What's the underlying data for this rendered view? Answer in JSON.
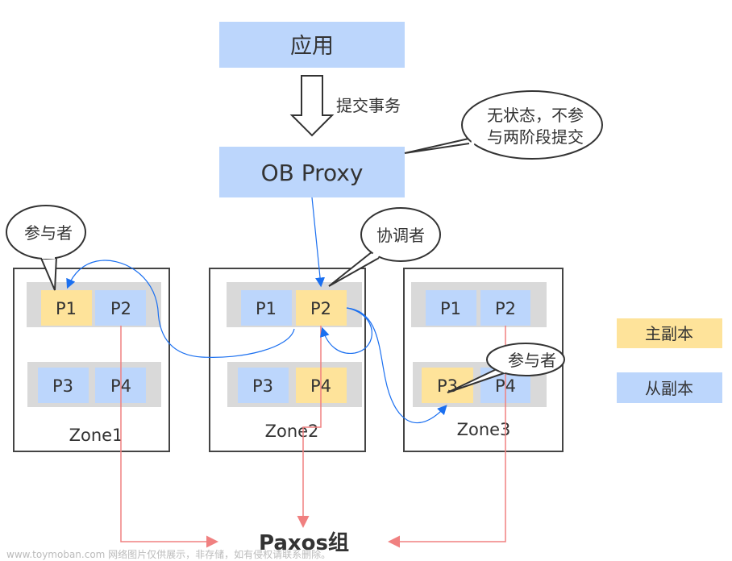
{
  "colors": {
    "primary_replica": "#fee39a",
    "secondary_replica": "#bcd6fc",
    "zone_row": "#d9d9d9",
    "control_flow": "#1a6ff0",
    "paxos_flow": "#f08080"
  },
  "app": {
    "label": "应用"
  },
  "submit_arrow": {
    "label": "提交事务"
  },
  "proxy": {
    "label": "OB Proxy"
  },
  "callouts": {
    "proxy_note": {
      "line1": "无状态，不参",
      "line2": "与两阶段提交"
    },
    "zone1_participant": "参与者",
    "coordinator": "协调者",
    "zone3_participant": "参与者"
  },
  "zones": [
    {
      "label": "Zone1",
      "partitions": [
        "P1",
        "P2",
        "P3",
        "P4"
      ]
    },
    {
      "label": "Zone2",
      "partitions": [
        "P1",
        "P2",
        "P3",
        "P4"
      ]
    },
    {
      "label": "Zone3",
      "partitions": [
        "P1",
        "P2",
        "P3",
        "P4"
      ]
    }
  ],
  "legend": {
    "primary": "主副本",
    "secondary": "从副本"
  },
  "paxos": {
    "label": "Paxos组"
  },
  "watermark": "www.toymoban.com 网络图片仅供展示，非存储，如有侵权请联系删除。"
}
